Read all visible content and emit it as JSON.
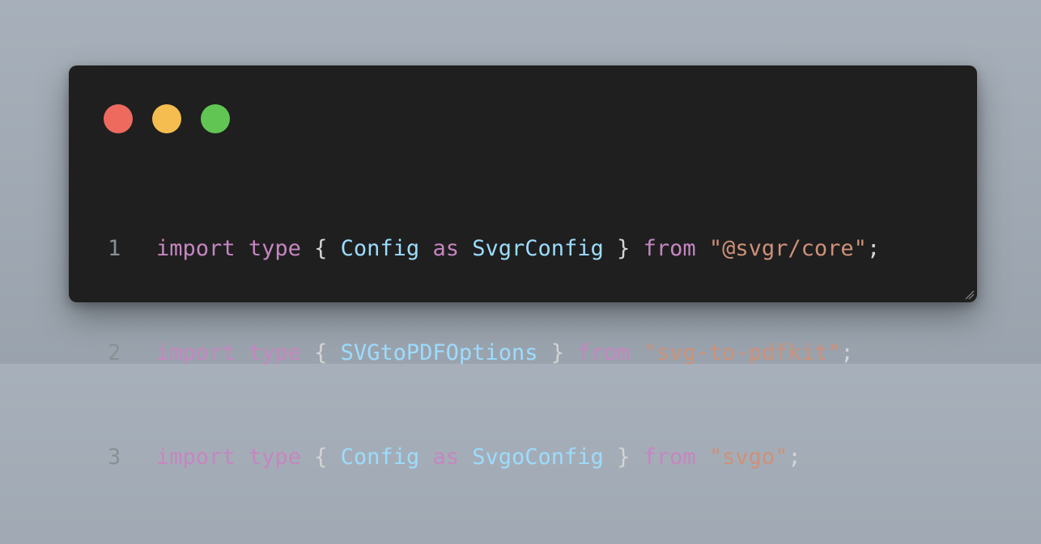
{
  "window": {
    "controls": [
      {
        "name": "close",
        "color": "#ee6a5f"
      },
      {
        "name": "minimize",
        "color": "#f5bd4f"
      },
      {
        "name": "maximize",
        "color": "#61c554"
      }
    ]
  },
  "code": {
    "lines": [
      {
        "number": "1",
        "tokens": [
          {
            "text": "import",
            "kind": "keyword"
          },
          {
            "text": " ",
            "kind": "punct"
          },
          {
            "text": "type",
            "kind": "keyword"
          },
          {
            "text": " { ",
            "kind": "punct"
          },
          {
            "text": "Config",
            "kind": "ident"
          },
          {
            "text": " ",
            "kind": "punct"
          },
          {
            "text": "as",
            "kind": "keyword"
          },
          {
            "text": " ",
            "kind": "punct"
          },
          {
            "text": "SvgrConfig",
            "kind": "ident"
          },
          {
            "text": " } ",
            "kind": "punct"
          },
          {
            "text": "from",
            "kind": "keyword"
          },
          {
            "text": " ",
            "kind": "punct"
          },
          {
            "text": "\"@svgr/core\"",
            "kind": "string"
          },
          {
            "text": ";",
            "kind": "punct"
          }
        ]
      },
      {
        "number": "2",
        "tokens": [
          {
            "text": "import",
            "kind": "keyword"
          },
          {
            "text": " ",
            "kind": "punct"
          },
          {
            "text": "type",
            "kind": "keyword"
          },
          {
            "text": " { ",
            "kind": "punct"
          },
          {
            "text": "SVGtoPDFOptions",
            "kind": "ident"
          },
          {
            "text": " } ",
            "kind": "punct"
          },
          {
            "text": "from",
            "kind": "keyword"
          },
          {
            "text": " ",
            "kind": "punct"
          },
          {
            "text": "\"svg-to-pdfkit\"",
            "kind": "string"
          },
          {
            "text": ";",
            "kind": "punct"
          }
        ]
      },
      {
        "number": "3",
        "tokens": [
          {
            "text": "import",
            "kind": "keyword"
          },
          {
            "text": " ",
            "kind": "punct"
          },
          {
            "text": "type",
            "kind": "keyword"
          },
          {
            "text": " { ",
            "kind": "punct"
          },
          {
            "text": "Config",
            "kind": "ident"
          },
          {
            "text": " ",
            "kind": "punct"
          },
          {
            "text": "as",
            "kind": "keyword"
          },
          {
            "text": " ",
            "kind": "punct"
          },
          {
            "text": "SvgoConfig",
            "kind": "ident"
          },
          {
            "text": " } ",
            "kind": "punct"
          },
          {
            "text": "from",
            "kind": "keyword"
          },
          {
            "text": " ",
            "kind": "punct"
          },
          {
            "text": "\"svgo\"",
            "kind": "string"
          },
          {
            "text": ";",
            "kind": "punct"
          }
        ]
      }
    ]
  },
  "resize_handle": {
    "icon": "resize-grip-icon"
  }
}
